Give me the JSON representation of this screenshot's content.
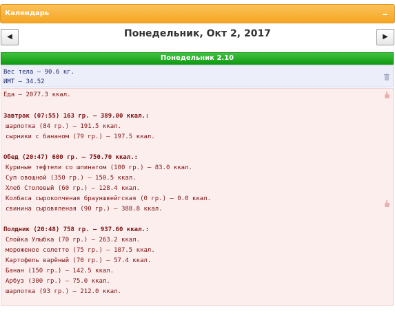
{
  "titlebar": {
    "title": "Календарь"
  },
  "nav": {
    "prev_label": "◀",
    "next_label": "▶",
    "date_title": "Понедельник, Окт 2, 2017"
  },
  "day_header": "Понедельник 2.10",
  "body_stats": {
    "weight": "Вес тела – 90.6 кг.",
    "bmi": "ИМТ – 34.52"
  },
  "food": {
    "total": "Еда – 2077.3 ккал.",
    "meals": [
      {
        "header": "Завтрак (07:55) 163 гр. – 389.00 ккал.:",
        "items": [
          "шарлотка (84 гр.) – 191.5 ккал.",
          "сырники с бананом (79 гр.) – 197.5 ккал."
        ]
      },
      {
        "header": "Обед (20:47) 600 гр. – 750.70 ккал.:",
        "items": [
          "Куриные тефтели со шпинатом (100 гр.) – 83.0 ккал.",
          "Суп овощной (350 гр.) – 150.5 ккал.",
          "Хлеб Столовый (60 гр.) – 128.4 ккал.",
          "Колбаса сырокопченая брауншвейгская (0 гр.) – 0.0 ккал.",
          "свинина сыровяленая (90 гр.) – 388.8 ккал."
        ]
      },
      {
        "header": "Полдник (20:48) 758 гр. – 937.60 ккал.:",
        "items": [
          "Слойка Улыбка (70 гр.) – 263.2 ккал.",
          "мороженое солетто (75 гр.) – 187.5 ккал.",
          "Картофель варёный (70 гр.) – 57.4 ккал.",
          "Банан (150 гр.) – 142.5 ккал.",
          "Арбуз (300 гр.) – 75.0 ккал.",
          "шарлотка (93 гр.) – 212.0 ккал."
        ]
      }
    ]
  },
  "icons": {
    "minimize": "minimize-icon",
    "trash": "trash-icon",
    "hand": "hand-pointer-icon"
  },
  "colors": {
    "titlebar": "#f5a623",
    "day_header": "#129a12",
    "weight_bg": "#eceefa",
    "food_bg": "#fdeeee",
    "food_text": "#7a1212"
  }
}
